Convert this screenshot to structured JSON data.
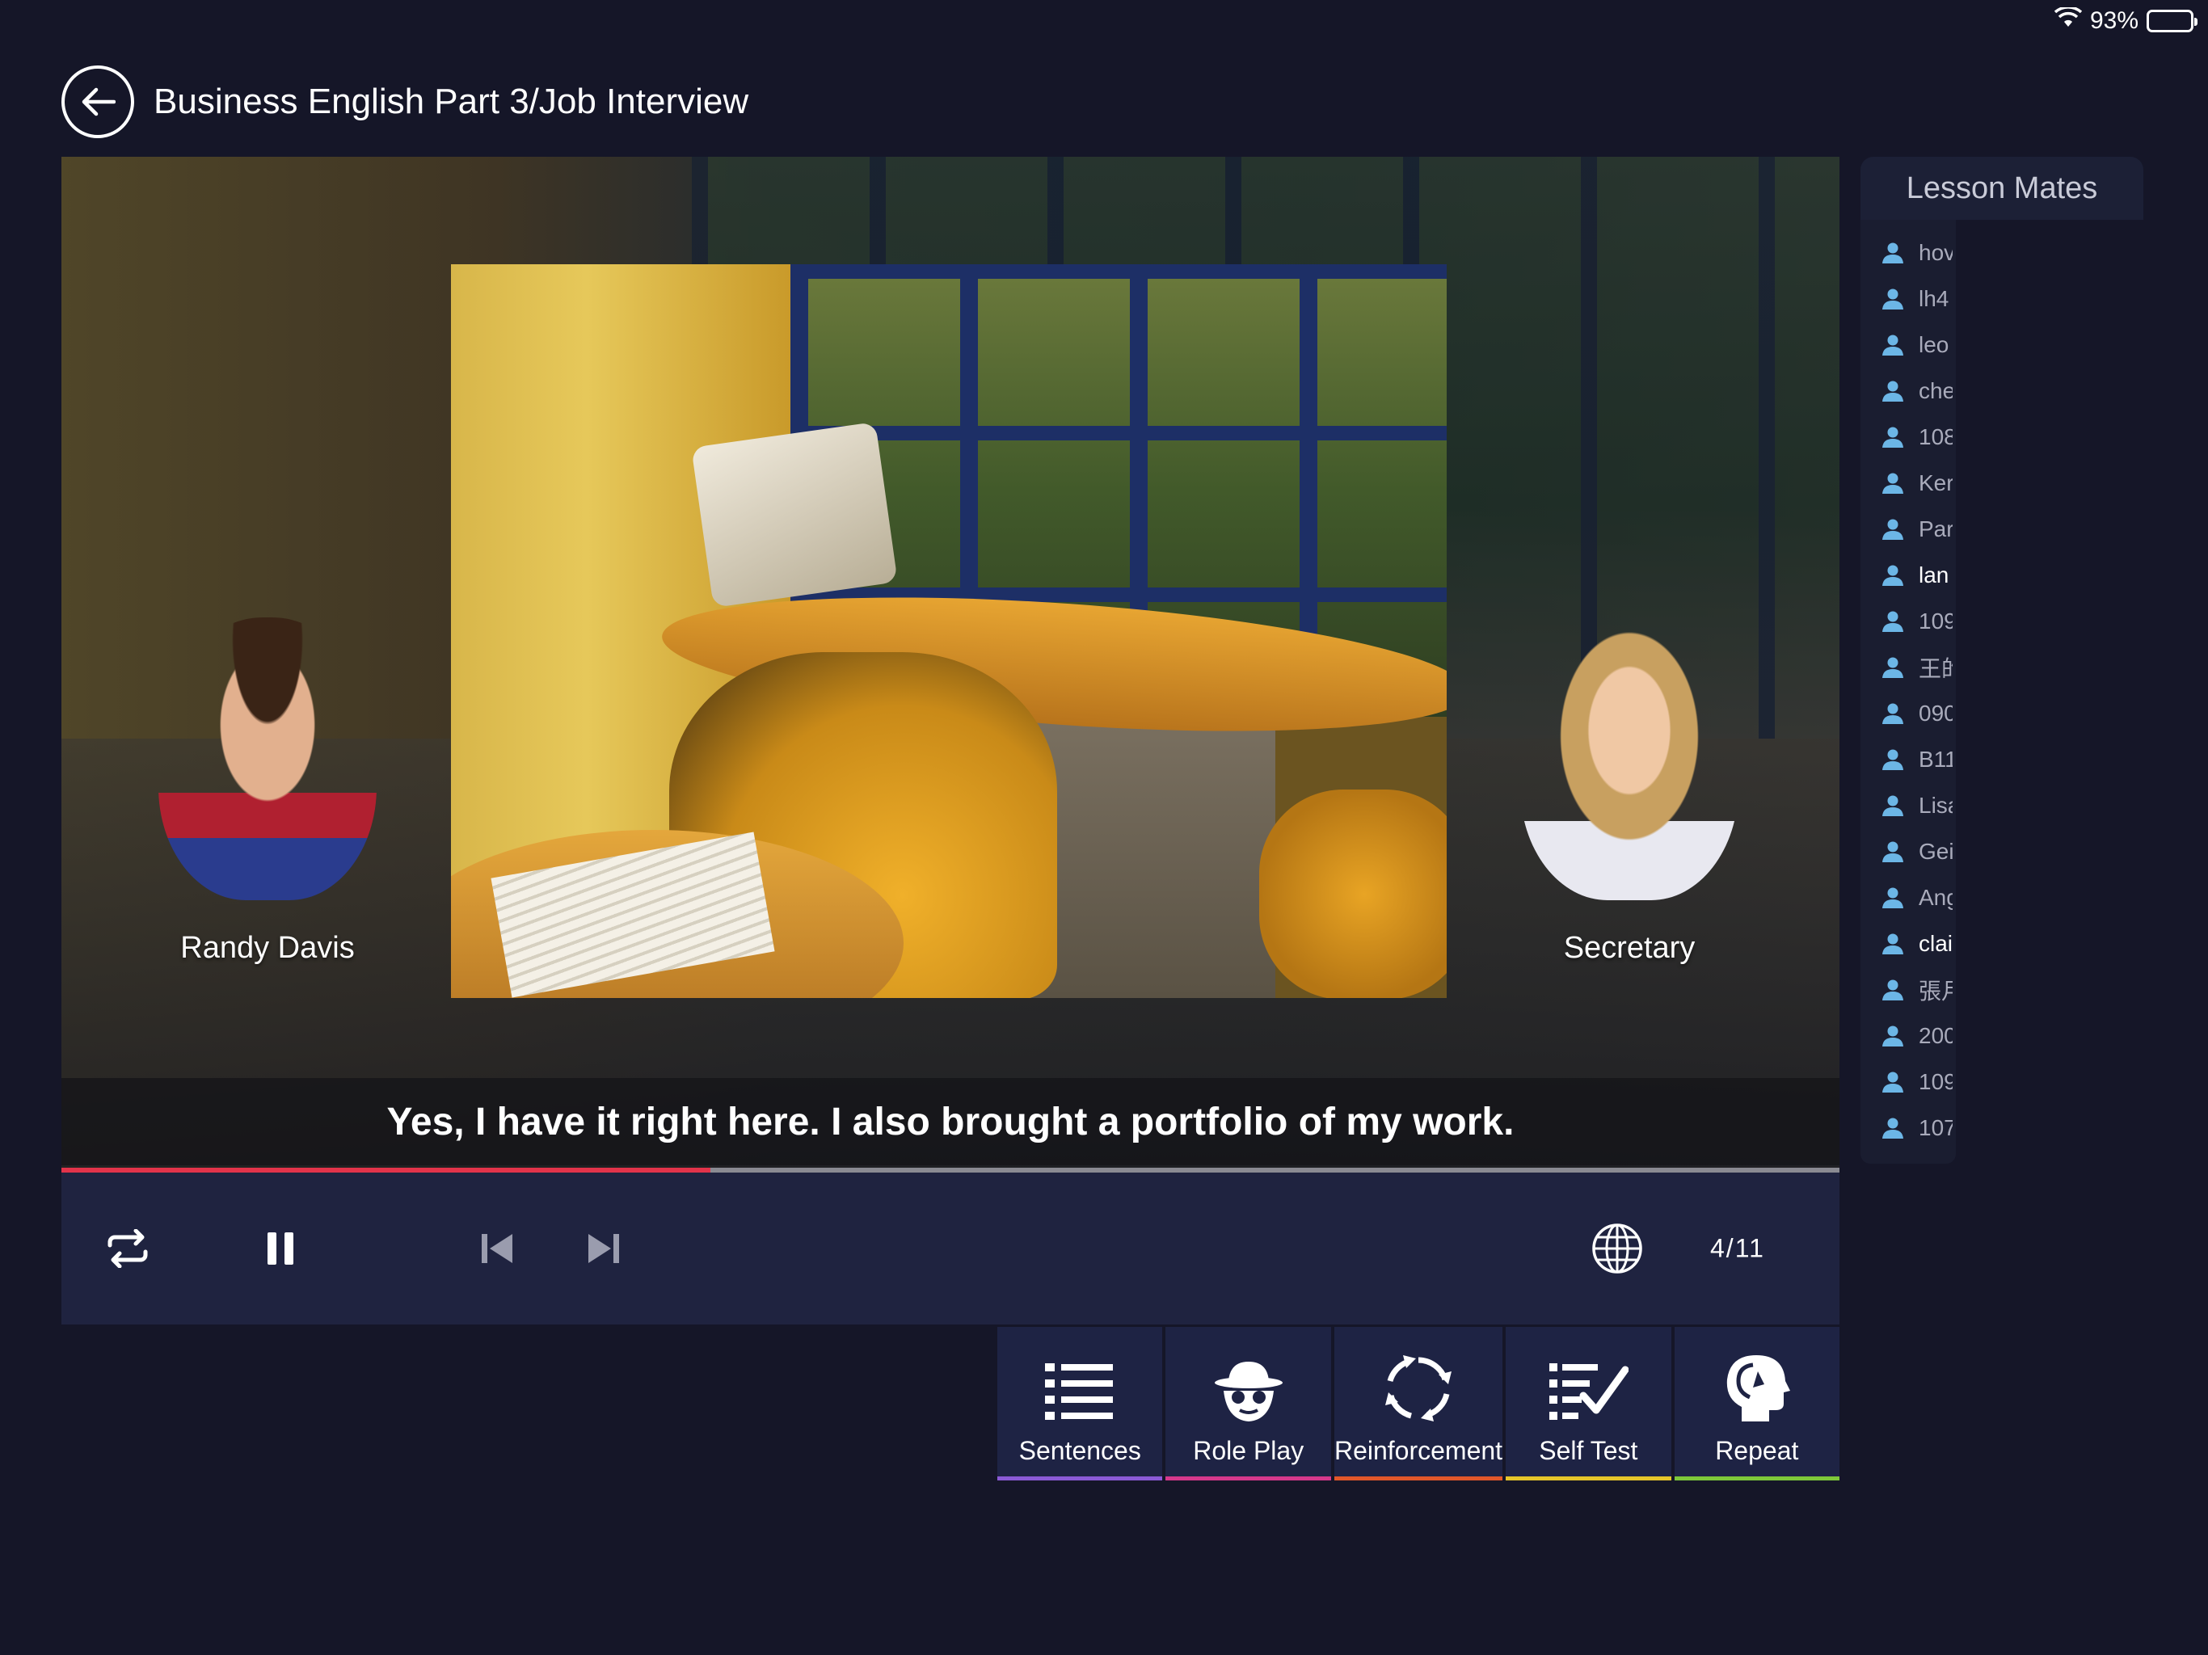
{
  "status": {
    "battery": "93%"
  },
  "header": {
    "title": "Business English Part 3/Job Interview"
  },
  "stage": {
    "characters": [
      {
        "name": "Randy Davis"
      },
      {
        "name": "Secretary"
      }
    ],
    "subtitle": "Yes, I have it right here. I also brought a portfolio of my work."
  },
  "playback": {
    "progress_fraction": 0.365,
    "counter": "4/11"
  },
  "actions": [
    {
      "label": "Sentences",
      "color": "#8b5ad6"
    },
    {
      "label": "Role Play",
      "color": "#d6388c"
    },
    {
      "label": "Reinforcement",
      "color": "#e2572a"
    },
    {
      "label": "Self Test",
      "color": "#e6c52a"
    },
    {
      "label": "Repeat",
      "color": "#7ec83a"
    }
  ],
  "mates": {
    "title": "Lesson Mates",
    "icon_color": "#6cb6e6",
    "items": [
      "hov",
      "lh4",
      "leo",
      "che",
      "108",
      "Ker",
      "Par",
      "lan",
      "109",
      "王的",
      "090",
      "B11",
      "Lisa",
      "Gei",
      "Ang",
      "clai",
      "張月",
      "200",
      "109",
      "107"
    ]
  }
}
